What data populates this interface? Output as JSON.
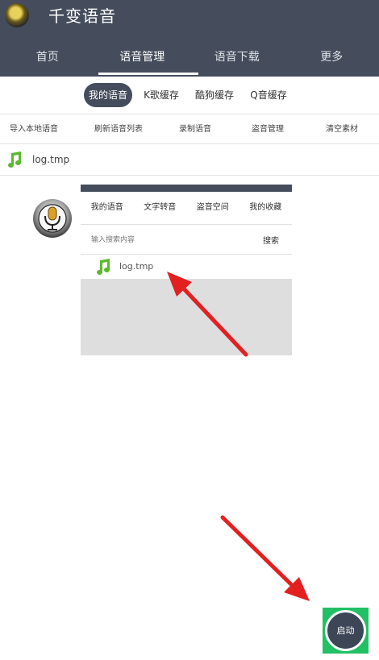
{
  "app": {
    "title": "千变语音"
  },
  "main_tabs": [
    {
      "label": "首页"
    },
    {
      "label": "语音管理"
    },
    {
      "label": "语音下载"
    },
    {
      "label": "更多"
    }
  ],
  "sub_tabs": [
    {
      "label": "我的语音"
    },
    {
      "label": "K歌缓存"
    },
    {
      "label": "酷狗缓存"
    },
    {
      "label": "Q音缓存"
    }
  ],
  "actions": [
    {
      "label": "导入本地语音"
    },
    {
      "label": "刷新语音列表"
    },
    {
      "label": "录制语音"
    },
    {
      "label": "盗音管理"
    },
    {
      "label": "清空素材"
    }
  ],
  "file_list": [
    {
      "name": "log.tmp",
      "icon": "music-note-icon"
    }
  ],
  "preview": {
    "tabs": [
      {
        "label": "我的语音"
      },
      {
        "label": "文字转音"
      },
      {
        "label": "盗音空间"
      },
      {
        "label": "我的收藏"
      }
    ],
    "search_placeholder": "输入搜索内容",
    "search_button": "搜索",
    "file_name": "log.tmp"
  },
  "start_button": {
    "label": "启动"
  },
  "colors": {
    "header": "#454d5c",
    "music_note": "#5cb82e",
    "start_bg": "#22c064",
    "annotation_arrow": "#e32020"
  }
}
